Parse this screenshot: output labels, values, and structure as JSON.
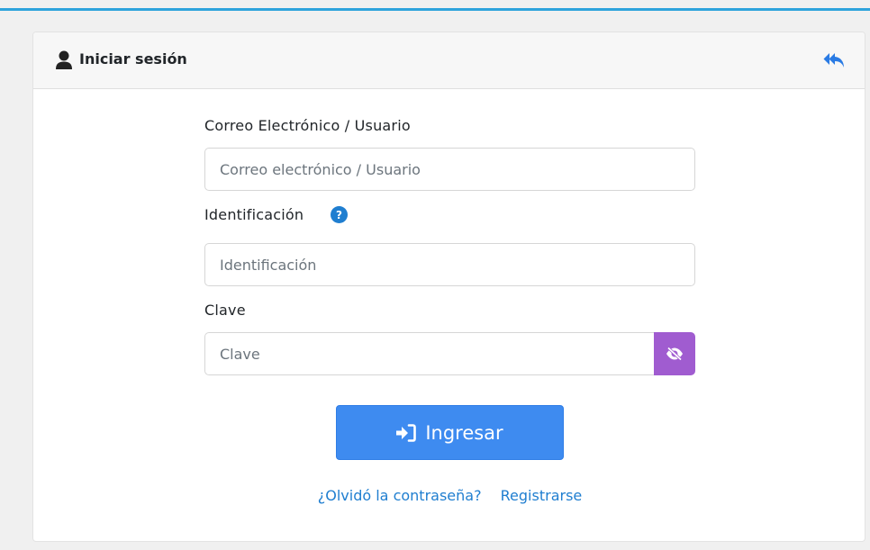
{
  "header": {
    "title": "Iniciar sesión",
    "user_icon": "user-icon",
    "back_icon": "reply-all-icon"
  },
  "form": {
    "email": {
      "label": "Correo Electrónico / Usuario",
      "placeholder": "Correo electrónico / Usuario",
      "value": ""
    },
    "identification": {
      "label": "Identificación",
      "placeholder": "Identificación",
      "value": "",
      "help_icon": "question-circle-icon"
    },
    "password": {
      "label": "Clave",
      "placeholder": "Clave",
      "value": "",
      "toggle_icon": "eye-slash-icon"
    },
    "submit": {
      "label": "Ingresar",
      "icon": "sign-in-icon"
    }
  },
  "links": {
    "forgot": "¿Olvidó la contraseña?",
    "register": "Registrarse"
  },
  "colors": {
    "accent_bar": "#2ea3dc",
    "primary_button": "#3e8bf0",
    "toggle_button": "#a05cd0",
    "link": "#1f7ed0"
  }
}
